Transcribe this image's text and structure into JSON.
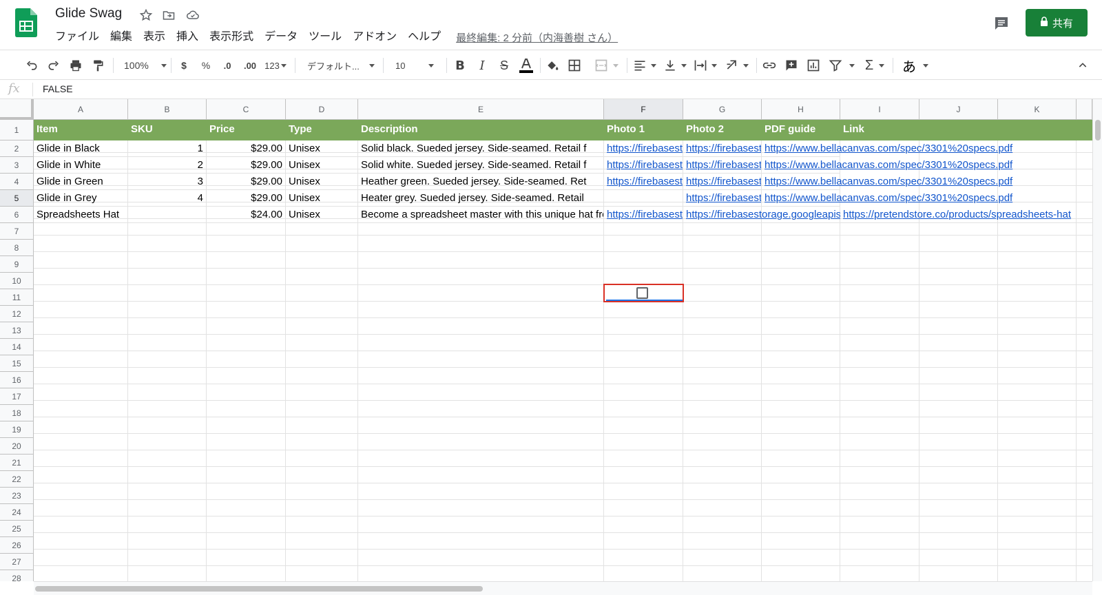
{
  "doc": {
    "title": "Glide Swag",
    "last_edit": "最終編集: 2 分前（内海善樹 さん）"
  },
  "menu": [
    "ファイル",
    "編集",
    "表示",
    "挿入",
    "表示形式",
    "データ",
    "ツール",
    "アドオン",
    "ヘルプ"
  ],
  "share_label": "共有",
  "toolbar": {
    "zoom": "100%",
    "currency": "$",
    "percent": "%",
    "dec_less": ".0",
    "dec_more": ".00",
    "number_format": "123",
    "font": "デフォルト...",
    "font_size": "10",
    "input_tool": "あ"
  },
  "formula": {
    "fx": "fx",
    "value": "FALSE"
  },
  "columns": [
    "A",
    "B",
    "C",
    "D",
    "E",
    "F",
    "G",
    "H",
    "I",
    "J",
    "K"
  ],
  "active_column": "F",
  "active_row": "5",
  "row_numbers": [
    "1",
    "2",
    "3",
    "4",
    "5",
    "6",
    "7",
    "8",
    "9",
    "10",
    "11",
    "12",
    "13",
    "14",
    "15",
    "16",
    "17",
    "18",
    "19",
    "20",
    "21",
    "22",
    "23",
    "24",
    "25",
    "26",
    "27",
    "28"
  ],
  "headers": [
    "Item",
    "SKU",
    "Price",
    "Type",
    "Description",
    "Photo 1",
    "Photo 2",
    "PDF guide",
    "Link"
  ],
  "rows": [
    {
      "item": "Glide in Black",
      "sku": "1",
      "price": "$29.00",
      "type": "Unisex",
      "description": "Solid black. Sueded jersey. Side-seamed. Retail f",
      "photo1": "https://firebasest",
      "photo2": "https://firebasest",
      "pdf": "https://www.bellacanvas.com/spec/3301%20specs.pdf",
      "link": ""
    },
    {
      "item": "Glide in White",
      "sku": "2",
      "price": "$29.00",
      "type": "Unisex",
      "description": "Solid white. Sueded jersey. Side-seamed. Retail f",
      "photo1": "https://firebasest",
      "photo2": "https://firebasest",
      "pdf": "https://www.bellacanvas.com/spec/3301%20specs.pdf",
      "link": ""
    },
    {
      "item": "Glide in Green",
      "sku": "3",
      "price": "$29.00",
      "type": "Unisex",
      "description": "Heather green. Sueded jersey. Side-seamed. Ret",
      "photo1": "https://firebasest",
      "photo2": "https://firebasest",
      "pdf": "https://www.bellacanvas.com/spec/3301%20specs.pdf",
      "link": ""
    },
    {
      "item": "Glide in Grey",
      "sku": "4",
      "price": "$29.00",
      "type": "Unisex",
      "description": "Heater grey. Sueded jersey. Side-seamed. Retail",
      "photo1": "",
      "photo2": "https://firebasest",
      "pdf": "https://www.bellacanvas.com/spec/3301%20specs.pdf",
      "link": ""
    },
    {
      "item": "Spreadsheets Hat",
      "sku": "",
      "price": "$24.00",
      "type": "Unisex",
      "description": "Become a spreadsheet master with this unique hat fro",
      "photo1": "https://firebasest",
      "photo2": "https://firebasestorage.googleapis.",
      "pdf": "",
      "link": "https://pretendstore.co/products/spreadsheets-hat"
    }
  ],
  "selected_cell": {
    "ref": "F5",
    "checkbox_checked": false
  },
  "colors": {
    "header_fill": "#7ba85a",
    "share_button": "#188038",
    "link": "#1155cc",
    "selection_border": "#d93025"
  },
  "icons": [
    "sheets-logo-icon",
    "star-icon",
    "move-folder-icon",
    "cloud-status-icon",
    "comment-icon",
    "lock-icon",
    "undo-icon",
    "redo-icon",
    "print-icon",
    "paint-format-icon",
    "bold-icon",
    "italic-icon",
    "strikethrough-icon",
    "text-color-icon",
    "fill-color-icon",
    "borders-icon",
    "merge-cells-icon",
    "align-horizontal-icon",
    "align-vertical-icon",
    "text-wrap-icon",
    "text-rotate-icon",
    "link-icon",
    "comment-insert-icon",
    "chart-icon",
    "filter-icon",
    "functions-icon",
    "collapse-icon"
  ]
}
